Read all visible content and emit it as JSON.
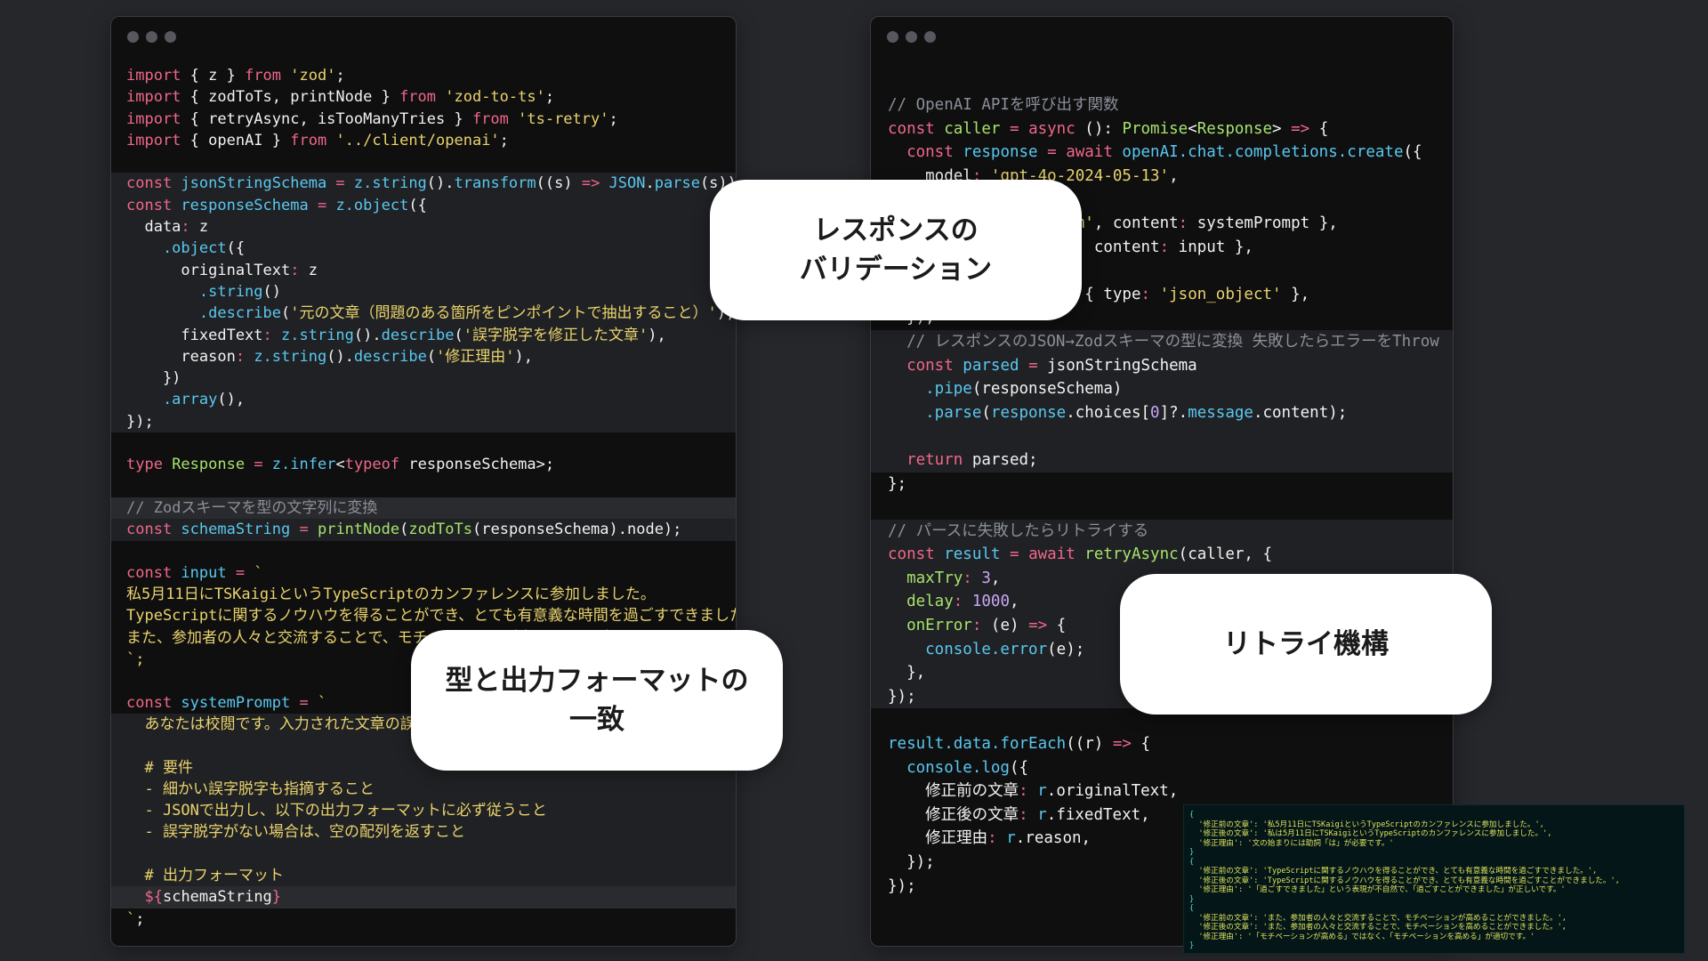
{
  "left_window": {
    "lines": [
      [
        [
          "k",
          "import"
        ],
        [
          "v",
          " { z } "
        ],
        [
          "k",
          "from"
        ],
        [
          "s",
          " 'zod'"
        ],
        [
          "v",
          ";"
        ]
      ],
      [
        [
          "k",
          "import"
        ],
        [
          "v",
          " { zodToTs, printNode } "
        ],
        [
          "k",
          "from"
        ],
        [
          "s",
          " 'zod-to-ts'"
        ],
        [
          "v",
          ";"
        ]
      ],
      [
        [
          "k",
          "import"
        ],
        [
          "v",
          " { retryAsync, isTooManyTries } "
        ],
        [
          "k",
          "from"
        ],
        [
          "s",
          " 'ts-retry'"
        ],
        [
          "v",
          ";"
        ]
      ],
      [
        [
          "k",
          "import"
        ],
        [
          "v",
          " { openAI } "
        ],
        [
          "k",
          "from"
        ],
        [
          "s",
          " '../client/openai'"
        ],
        [
          "v",
          ";"
        ]
      ],
      [],
      [
        [
          "k",
          "const"
        ],
        [
          "f",
          " jsonStringSchema"
        ],
        [
          "o",
          " = "
        ],
        [
          "f",
          "z.string"
        ],
        [
          "v",
          "()."
        ],
        [
          "f",
          "transform"
        ],
        [
          "v",
          "((s) "
        ],
        [
          "o",
          "=>"
        ],
        [
          "f",
          " JSON"
        ],
        [
          "v",
          "."
        ],
        [
          "f",
          "parse"
        ],
        [
          "v",
          "(s));"
        ]
      ],
      [
        [
          "k",
          "const"
        ],
        [
          "f",
          " responseSchema"
        ],
        [
          "o",
          " = "
        ],
        [
          "f",
          "z.object"
        ],
        [
          "v",
          "({"
        ]
      ],
      [
        [
          "v",
          "  data"
        ],
        [
          "o",
          ":"
        ],
        [
          "v",
          " z"
        ]
      ],
      [
        [
          "f",
          "    .object"
        ],
        [
          "v",
          "({"
        ]
      ],
      [
        [
          "v",
          "      originalText"
        ],
        [
          "o",
          ":"
        ],
        [
          "v",
          " z"
        ]
      ],
      [
        [
          "f",
          "        .string"
        ],
        [
          "v",
          "()"
        ]
      ],
      [
        [
          "f",
          "        .describe"
        ],
        [
          "v",
          "("
        ],
        [
          "s",
          "'元の文章（問題のある箇所をピンポイントで抽出すること）'"
        ],
        [
          "v",
          "),"
        ]
      ],
      [
        [
          "v",
          "      fixedText"
        ],
        [
          "o",
          ":"
        ],
        [
          "f",
          " z.string"
        ],
        [
          "v",
          "()."
        ],
        [
          "f",
          "describe"
        ],
        [
          "v",
          "("
        ],
        [
          "s",
          "'誤字脱字を修正した文章'"
        ],
        [
          "v",
          "),"
        ]
      ],
      [
        [
          "v",
          "      reason"
        ],
        [
          "o",
          ":"
        ],
        [
          "f",
          " z.string"
        ],
        [
          "v",
          "()."
        ],
        [
          "f",
          "describe"
        ],
        [
          "v",
          "("
        ],
        [
          "s",
          "'修正理由'"
        ],
        [
          "v",
          "),"
        ]
      ],
      [
        [
          "v",
          "    })"
        ]
      ],
      [
        [
          "f",
          "    .array"
        ],
        [
          "v",
          "(),"
        ]
      ],
      [
        [
          "v",
          "});"
        ]
      ],
      [],
      [
        [
          "k",
          "type"
        ],
        [
          "t",
          " Response"
        ],
        [
          "o",
          " = "
        ],
        [
          "f",
          "z.infer"
        ],
        [
          "v",
          "<"
        ],
        [
          "k",
          "typeof"
        ],
        [
          "v",
          " responseSchema>;"
        ]
      ],
      [],
      [
        [
          "c",
          "// Zodスキーマを型の文字列に変換"
        ]
      ],
      [
        [
          "k",
          "const"
        ],
        [
          "f",
          " schemaString"
        ],
        [
          "o",
          " = "
        ],
        [
          "t",
          "printNode"
        ],
        [
          "v",
          "("
        ],
        [
          "t",
          "zodToTs"
        ],
        [
          "v",
          "(responseSchema).node);"
        ]
      ],
      [],
      [
        [
          "k",
          "const"
        ],
        [
          "f",
          " input"
        ],
        [
          "o",
          " = "
        ],
        [
          "s",
          "`"
        ]
      ],
      [
        [
          "s",
          "私5月11日にTSKaigiというTypeScriptのカンファレンスに参加しました。"
        ]
      ],
      [
        [
          "s",
          "TypeScriptに関するノウハウを得ることができ、とても有意義な時間を過ごすできました。"
        ]
      ],
      [
        [
          "s",
          "また、参加者の人々と交流することで、モチベーションが高めることができました。"
        ]
      ],
      [
        [
          "s",
          "`;"
        ]
      ],
      [],
      [
        [
          "k",
          "const"
        ],
        [
          "f",
          " systemPrompt"
        ],
        [
          "o",
          " = "
        ],
        [
          "s",
          "`"
        ]
      ],
      [
        [
          "s",
          "  あなたは校閲です。入力された文章の誤字脱字を指摘してください。"
        ]
      ],
      [],
      [
        [
          "s",
          "  # 要件"
        ]
      ],
      [
        [
          "s",
          "  - 細かい誤字脱字も指摘すること"
        ]
      ],
      [
        [
          "s",
          "  - JSONで出力し、以下の出力フォーマットに必ず従うこと"
        ]
      ],
      [
        [
          "s",
          "  - 誤字脱字がない場合は、空の配列を返すこと"
        ]
      ],
      [],
      [
        [
          "s",
          "  # 出力フォーマット"
        ]
      ],
      [
        [
          "v",
          "  "
        ],
        [
          "o",
          "${"
        ],
        [
          "v",
          "schemaString"
        ],
        [
          "o",
          "}"
        ]
      ],
      [
        [
          "s",
          "`"
        ],
        [
          "v",
          ";"
        ]
      ]
    ]
  },
  "right_window": {
    "lines": [
      [
        [
          "c",
          "// OpenAI APIを呼び出す関数"
        ]
      ],
      [
        [
          "k",
          "const"
        ],
        [
          "t",
          " caller"
        ],
        [
          "o",
          " = "
        ],
        [
          "k",
          "async"
        ],
        [
          "v",
          " (): "
        ],
        [
          "t",
          "Promise"
        ],
        [
          "v",
          "<"
        ],
        [
          "t",
          "Response"
        ],
        [
          "v",
          "> "
        ],
        [
          "o",
          "=>"
        ],
        [
          "v",
          " {"
        ]
      ],
      [
        [
          "k",
          "  const"
        ],
        [
          "f",
          " response"
        ],
        [
          "o",
          " = "
        ],
        [
          "k",
          "await"
        ],
        [
          "f",
          " openAI.chat.completions.create"
        ],
        [
          "v",
          "({"
        ]
      ],
      [
        [
          "v",
          "    model"
        ],
        [
          "o",
          ":"
        ],
        [
          "s",
          " 'gpt-4o-2024-05-13'"
        ],
        [
          "v",
          ","
        ]
      ],
      [
        [
          "v",
          "    messages"
        ],
        [
          "o",
          ":"
        ],
        [
          "v",
          " ["
        ]
      ],
      [
        [
          "v",
          "      { role"
        ],
        [
          "o",
          ":"
        ],
        [
          "s",
          " 'system'"
        ],
        [
          "v",
          ", content"
        ],
        [
          "o",
          ":"
        ],
        [
          "v",
          " systemPrompt },"
        ]
      ],
      [
        [
          "v",
          "      { role"
        ],
        [
          "o",
          ":"
        ],
        [
          "s",
          " 'user'"
        ],
        [
          "v",
          ", content"
        ],
        [
          "o",
          ":"
        ],
        [
          "v",
          " input },"
        ]
      ],
      [
        [
          "v",
          "    ],"
        ]
      ],
      [
        [
          "v",
          "    response_format"
        ],
        [
          "o",
          ":"
        ],
        [
          "v",
          " { type"
        ],
        [
          "o",
          ":"
        ],
        [
          "s",
          " 'json_object'"
        ],
        [
          "v",
          " },"
        ]
      ],
      [
        [
          "v",
          "  });"
        ]
      ],
      [
        [
          "c",
          "  // レスポンスのJSON→Zodスキーマの型に変換 失敗したらエラーをThrow"
        ]
      ],
      [
        [
          "k",
          "  const"
        ],
        [
          "f",
          " parsed"
        ],
        [
          "o",
          " = "
        ],
        [
          "v",
          "jsonStringSchema"
        ]
      ],
      [
        [
          "f",
          "    .pipe"
        ],
        [
          "v",
          "(responseSchema)"
        ]
      ],
      [
        [
          "f",
          "    .parse"
        ],
        [
          "v",
          "("
        ],
        [
          "f",
          "response"
        ],
        [
          "v",
          ".choices["
        ],
        [
          "p",
          "0"
        ],
        [
          "v",
          "]?."
        ],
        [
          "f",
          "message"
        ],
        [
          "v",
          ".content);"
        ]
      ],
      [],
      [
        [
          "k",
          "  return"
        ],
        [
          "v",
          " parsed;"
        ]
      ],
      [
        [
          "v",
          "};"
        ]
      ],
      [],
      [
        [
          "c",
          "// パースに失敗したらリトライする"
        ]
      ],
      [
        [
          "k",
          "const"
        ],
        [
          "f",
          " result"
        ],
        [
          "o",
          " = "
        ],
        [
          "k",
          "await"
        ],
        [
          "t",
          " retryAsync"
        ],
        [
          "v",
          "(caller, {"
        ]
      ],
      [
        [
          "t",
          "  maxTry"
        ],
        [
          "o",
          ":"
        ],
        [
          "p",
          " 3"
        ],
        [
          "v",
          ","
        ]
      ],
      [
        [
          "t",
          "  delay"
        ],
        [
          "o",
          ":"
        ],
        [
          "p",
          " 1000"
        ],
        [
          "v",
          ","
        ]
      ],
      [
        [
          "t",
          "  onError"
        ],
        [
          "o",
          ":"
        ],
        [
          "v",
          " (e) "
        ],
        [
          "o",
          "=>"
        ],
        [
          "v",
          " {"
        ]
      ],
      [
        [
          "f",
          "    console.error"
        ],
        [
          "v",
          "(e);"
        ]
      ],
      [
        [
          "v",
          "  },"
        ]
      ],
      [
        [
          "v",
          "});"
        ]
      ],
      [],
      [
        [
          "f",
          "result.data.forEach"
        ],
        [
          "v",
          "((r) "
        ],
        [
          "o",
          "=>"
        ],
        [
          "v",
          " {"
        ]
      ],
      [
        [
          "f",
          "  console.log"
        ],
        [
          "v",
          "({"
        ]
      ],
      [
        [
          "v",
          "    修正前の文章"
        ],
        [
          "o",
          ":"
        ],
        [
          "f",
          " r"
        ],
        [
          "v",
          ".originalText,"
        ]
      ],
      [
        [
          "v",
          "    修正後の文章"
        ],
        [
          "o",
          ":"
        ],
        [
          "f",
          " r"
        ],
        [
          "v",
          ".fixedText,"
        ]
      ],
      [
        [
          "v",
          "    修正理由"
        ],
        [
          "o",
          ":"
        ],
        [
          "f",
          " r"
        ],
        [
          "v",
          ".reason,"
        ]
      ],
      [
        [
          "v",
          "  });"
        ]
      ],
      [
        [
          "v",
          "});"
        ]
      ]
    ]
  },
  "callouts": {
    "validation": "レスポンスの\nバリデーション",
    "format": "型と出力フォーマットの\n一致",
    "retry": "リトライ機構"
  },
  "terminal": {
    "lines": [
      "{",
      "  '修正前の文章': '私5月11日にTSKaigiというTypeScriptのカンファレンスに参加しました。',",
      "  '修正後の文章': '私は5月11日にTSKaigiというTypeScriptのカンファレンスに参加しました。',",
      "  '修正理由': '文の始まりには助詞「は」が必要です。'",
      "}",
      "{",
      "  '修正前の文章': 'TypeScriptに関するノウハウを得ることができ、とても有意義な時間を過ごすできました。',",
      "  '修正後の文章': 'TypeScriptに関するノウハウを得ることができ、とても有意義な時間を過ごすことができました。',",
      "  '修正理由': '「過ごすできました」という表現が不自然で、「過ごすことができました」が正しいです。'",
      "}",
      "{",
      "  '修正前の文章': 'また、参加者の人々と交流することで、モチベーションが高めることができました。',",
      "  '修正後の文章': 'また、参加者の人々と交流することで、モチベーションを高めることができました。',",
      "  '修正理由': '「モチベーションが高める」ではなく、「モチベーションを高める」が適切です。'",
      "}"
    ]
  }
}
